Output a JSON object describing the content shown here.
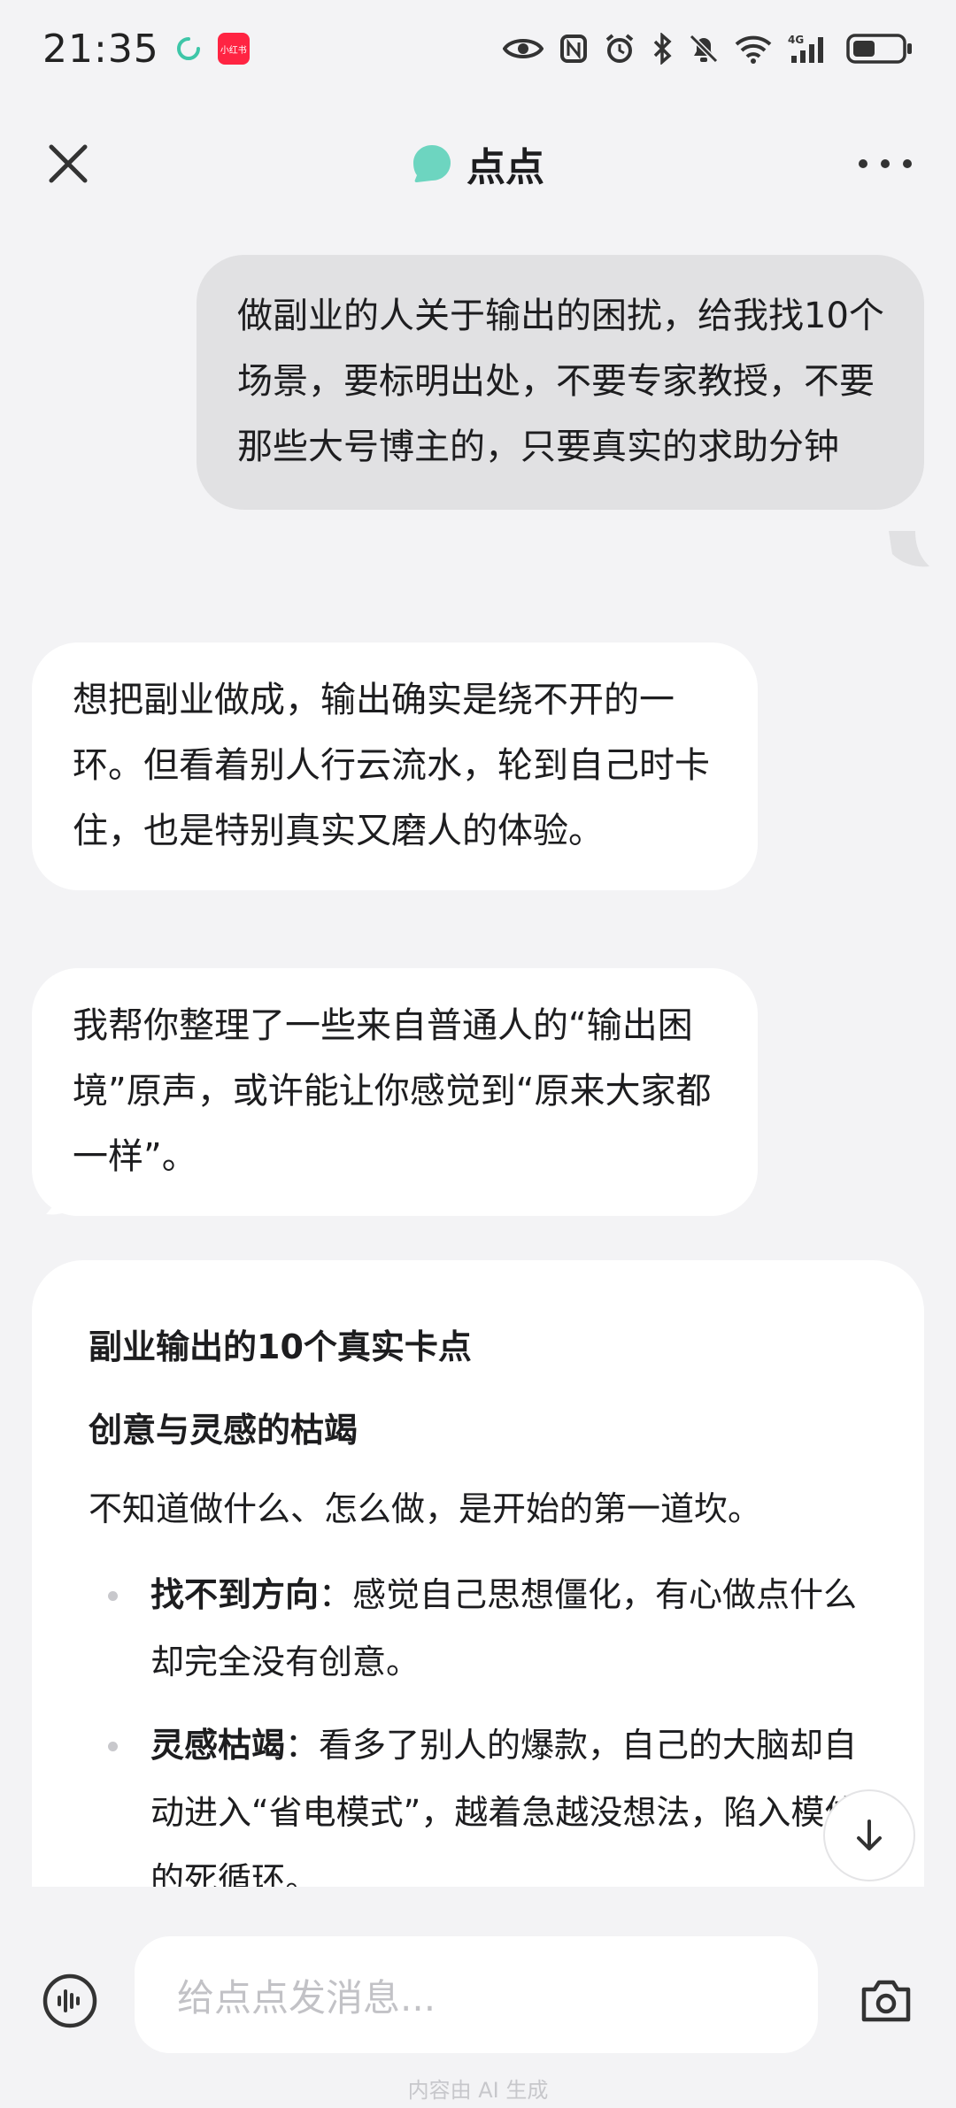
{
  "status_bar": {
    "time": "21:35",
    "app_badge": "小红书",
    "network": "4G"
  },
  "header": {
    "title": "点点"
  },
  "messages": {
    "user": "做副业的人关于输出的困扰，给我找10个场景，要标明出处，不要专家教授，不要那些大号博主的，只要真实的求助分钟",
    "bot_1": "想把副业做成，输出确实是绕不开的一环。但看着别人行云流水，轮到自己时卡住，也是特别真实又磨人的体验。",
    "bot_2": "我帮你整理了一些来自普通人的“输出困境”原声，或许能让你感觉到“原来大家都一样”。"
  },
  "card": {
    "title": "副业输出的10个真实卡点",
    "section_title": "创意与灵感的枯竭",
    "section_intro": "不知道做什么、怎么做，是开始的第一道坎。",
    "items": [
      {
        "term": "找不到方向",
        "sep": "：",
        "desc": "感觉自己思想僵化，有心做点什么却完全没有创意。"
      },
      {
        "term": "灵感枯竭",
        "sep": "：",
        "desc": "看多了别人的爆款，自己的大脑却自动进入“省电模式”，越着急越没想法，陷入模仿的死循环。"
      }
    ]
  },
  "input": {
    "placeholder": "给点点发消息..."
  },
  "footer": {
    "disclaimer": "内容由 AI 生成"
  },
  "colors": {
    "accent": "#6dd5c0",
    "user_bubble": "#e1e1e3",
    "background": "#f3f3f5"
  },
  "icons": {
    "close": "close-icon",
    "more": "more-icon",
    "scroll_down": "arrow-down-icon",
    "voice": "voice-icon",
    "camera": "camera-icon"
  }
}
